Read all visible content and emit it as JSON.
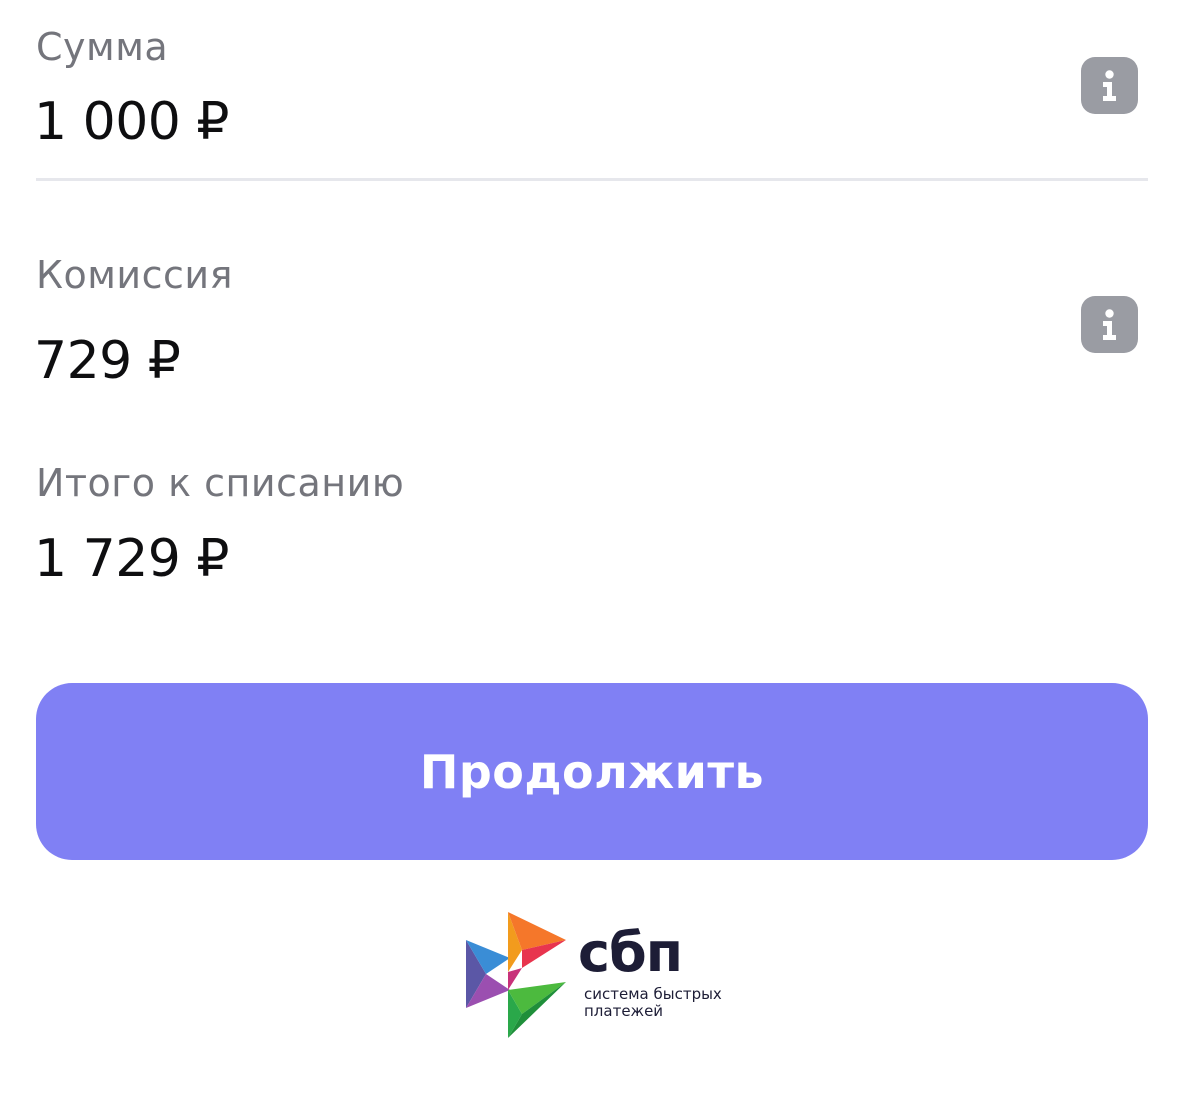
{
  "amount": {
    "label": "Сумма",
    "value": "1 000 ₽",
    "info_icon": "info-icon"
  },
  "commission": {
    "label": "Комиссия",
    "value": "729 ₽",
    "info_icon": "info-icon"
  },
  "total": {
    "label": "Итого к списанию",
    "value": "1 729 ₽"
  },
  "continue_button": {
    "label": "Продолжить",
    "color": "#8080f4"
  },
  "sbp_logo": {
    "wordmark": "сбп",
    "tagline_line1": "система быстрых",
    "tagline_line2": "платежей"
  },
  "colors": {
    "label_text": "#74757c",
    "value_text": "#0e0e10",
    "info_icon_bg": "#9a9ca3",
    "divider": "#e6e7ec"
  }
}
